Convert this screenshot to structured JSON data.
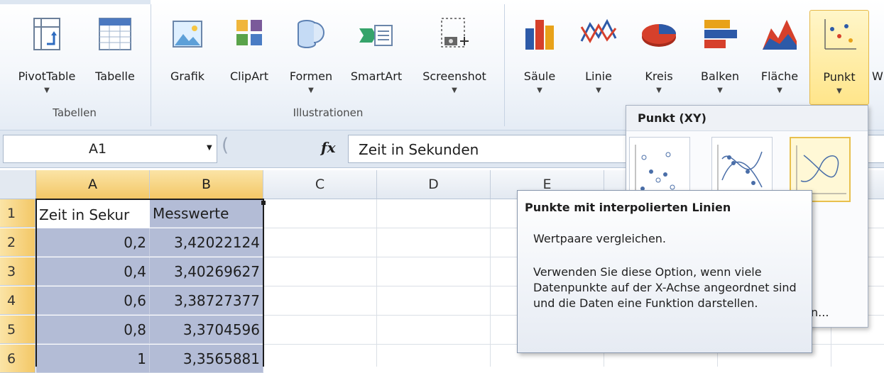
{
  "ribbon": {
    "buttons": {
      "pivottable": "PivotTable",
      "tabelle": "Tabelle",
      "grafik": "Grafik",
      "clipart": "ClipArt",
      "formen": "Formen",
      "smartart": "SmartArt",
      "screenshot": "Screenshot",
      "saeule": "Säule",
      "linie": "Linie",
      "kreis": "Kreis",
      "balken": "Balken",
      "flaeche": "Fläche",
      "punkt": "Punkt",
      "more": "W"
    },
    "groups": {
      "tabellen": "Tabellen",
      "illustrationen": "Illustrationen"
    }
  },
  "formula_bar": {
    "name_box": "A1",
    "fx": "fx",
    "content": "Zeit in Sekunden"
  },
  "grid": {
    "columns": [
      "A",
      "B",
      "C",
      "D",
      "E"
    ],
    "rows": [
      "1",
      "2",
      "3",
      "4",
      "5",
      "6"
    ],
    "header_row": {
      "a": "Zeit in Sekur",
      "b": "Messwerte"
    },
    "data": [
      {
        "a": "0,2",
        "b": "3,42022124"
      },
      {
        "a": "0,4",
        "b": "3,40269627"
      },
      {
        "a": "0,6",
        "b": "3,38727377"
      },
      {
        "a": "0,8",
        "b": "3,3704596"
      },
      {
        "a": "1",
        "b": "3,3565881"
      }
    ]
  },
  "dropdown": {
    "title": "Punkt (XY)",
    "more_link": "n..."
  },
  "tooltip": {
    "title": "Punkte mit interpolierten Linien",
    "line1": "Wertpaare vergleichen.",
    "description": "Verwenden Sie diese Option, wenn viele Datenpunkte auf der X-Achse angeordnet sind und die Daten eine Funktion darstellen."
  }
}
